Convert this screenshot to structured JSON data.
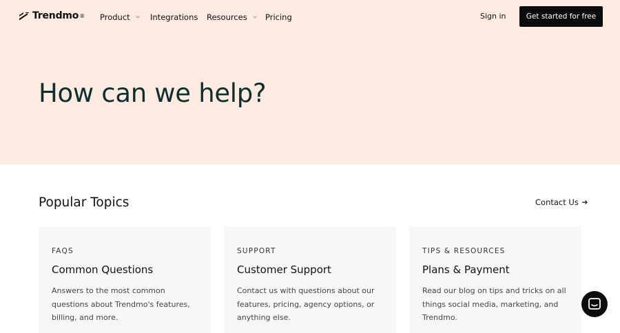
{
  "brand": {
    "name": "Trendmo",
    "mark": "®"
  },
  "nav": {
    "items": [
      {
        "label": "Product",
        "has_dropdown": true
      },
      {
        "label": "Integrations",
        "has_dropdown": false
      },
      {
        "label": "Resources",
        "has_dropdown": true
      },
      {
        "label": "Pricing",
        "has_dropdown": false
      }
    ],
    "sign_in": "Sign in",
    "cta": "Get started for free"
  },
  "hero": {
    "title": "How can we help?"
  },
  "topics": {
    "title": "Popular Topics",
    "contact_link": "Contact Us",
    "cards": [
      {
        "eyebrow": "FAQS",
        "title": "Common Questions",
        "description": "Answers to the most common questions about Trendmo's features, billing, and more."
      },
      {
        "eyebrow": "SUPPORT",
        "title": "Customer Support",
        "description": "Contact us with questions about our features, pricing, agency options, or anything else."
      },
      {
        "eyebrow": "TIPS & RESOURCES",
        "title": "Plans & Payment",
        "description": "Read our blog on tips and tricks on all things social media, marketing, and Trendmo."
      }
    ]
  },
  "icons": {
    "logo": "trendmo-logo-icon",
    "dropdown": "chevron-down-icon",
    "contact_arrow": "arrow-right-icon",
    "chat": "chat-icon"
  },
  "colors": {
    "hero_bg": "#fdebe1",
    "heading": "#0f2f2f",
    "cta_bg": "#0c0c0c",
    "card_bg": "#f7f7f7"
  }
}
